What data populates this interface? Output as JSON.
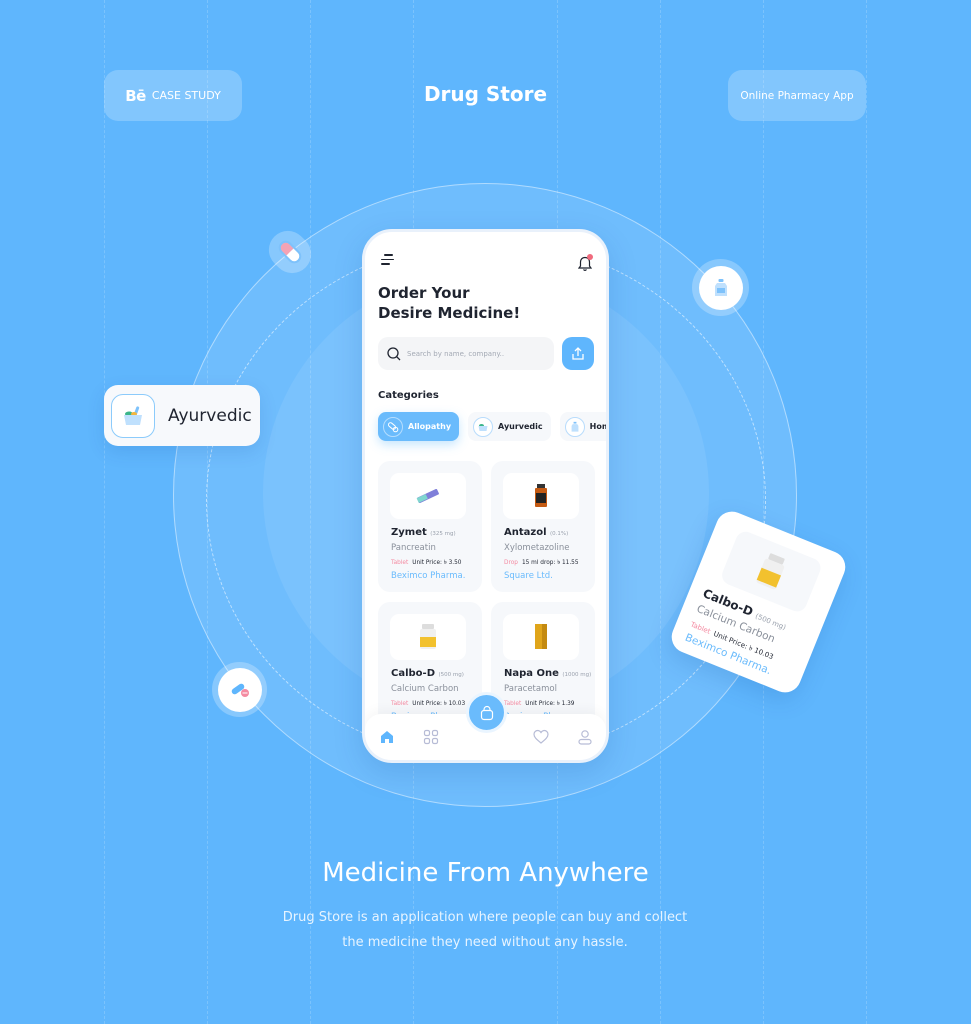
{
  "header": {
    "case_study_logo": "Bē",
    "case_study_label": "CASE STUDY",
    "title": "Drug Store",
    "tag_label": "Online Pharmacy App"
  },
  "floating": {
    "ayurvedic_card_label": "Ayurvedic",
    "icons": [
      "capsule-icon",
      "syrup-bottle-icon",
      "pills-icon"
    ]
  },
  "phone": {
    "headline_line1": "Order Your",
    "headline_line2": "Desire Medicine!",
    "notification_count": "1",
    "search": {
      "placeholder": "Search by name, company..",
      "value": ""
    },
    "categories_title": "Categories",
    "categories": [
      {
        "label": "Allopathy",
        "icon": "pills-icon",
        "active": true
      },
      {
        "label": "Ayurvedic",
        "icon": "herbal-bowl-icon",
        "active": false
      },
      {
        "label": "Homeo",
        "icon": "bottle-icon",
        "active": false
      }
    ],
    "products": [
      {
        "name": "Zymet",
        "dose": "(325 mg)",
        "generic": "Pancreatin",
        "type": "Tablet",
        "price": "Unit Price: ৳ 3.50",
        "company": "Beximco Pharma."
      },
      {
        "name": "Antazol",
        "dose": "(0.1%)",
        "generic": "Xylometazoline",
        "type": "Drop",
        "price": "15 ml drop: ৳ 11.55",
        "company": "Square Ltd."
      },
      {
        "name": "Calbo-D",
        "dose": "(500 mg)",
        "generic": "Calcium Carbon",
        "type": "Tablet",
        "price": "Unit Price: ৳ 10.03",
        "company": "Beximco Pharma."
      },
      {
        "name": "Napa One",
        "dose": "(1000 mg)",
        "generic": "Paracetamol",
        "type": "Tablet",
        "price": "Unit Price: ৳ 1.39",
        "company": "Beximco Pharma."
      }
    ],
    "tabbar": [
      "home-icon",
      "grid-icon",
      "cart-icon",
      "heart-icon",
      "profile-icon"
    ]
  },
  "featured_card": {
    "name": "Calbo-D",
    "dose": "(500 mg)",
    "generic": "Calcium Carbon",
    "type": "Tablet",
    "price": "Unit Price: ৳ 10.03",
    "company": "Beximco Pharma."
  },
  "footer": {
    "title": "Medicine From Anywhere",
    "description_line1": "Drug Store is an application where people can buy and collect",
    "description_line2": "the medicine they need without any hassle."
  },
  "colors": {
    "background": "#5fb6fd",
    "accent": "#6abbfc",
    "tag_pink": "#f48aa1",
    "text_dark": "#1f2430"
  }
}
